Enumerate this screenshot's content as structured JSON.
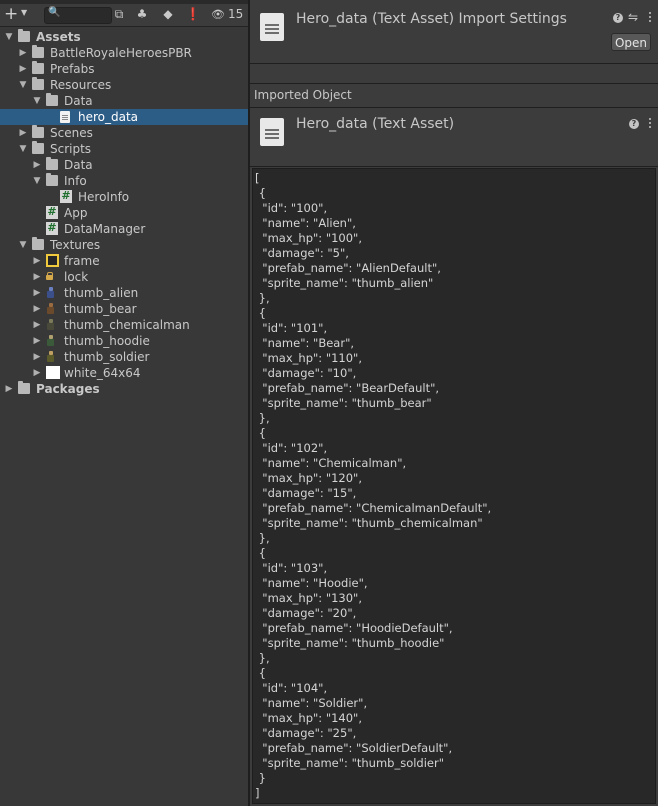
{
  "project": {
    "search": {
      "placeholder": ""
    },
    "hidden_count": "15",
    "tree": [
      {
        "label": "Assets",
        "indent": 0,
        "arrow": "open",
        "icon": "folder",
        "bold": true
      },
      {
        "label": "BattleRoyaleHeroesPBR",
        "indent": 1,
        "arrow": "closed",
        "icon": "folder"
      },
      {
        "label": "Prefabs",
        "indent": 1,
        "arrow": "closed",
        "icon": "folder"
      },
      {
        "label": "Resources",
        "indent": 1,
        "arrow": "open",
        "icon": "folder"
      },
      {
        "label": "Data",
        "indent": 2,
        "arrow": "open",
        "icon": "folder"
      },
      {
        "label": "hero_data",
        "indent": 3,
        "arrow": "none",
        "icon": "text",
        "selected": true
      },
      {
        "label": "Scenes",
        "indent": 1,
        "arrow": "closed",
        "icon": "folder"
      },
      {
        "label": "Scripts",
        "indent": 1,
        "arrow": "open",
        "icon": "folder"
      },
      {
        "label": "Data",
        "indent": 2,
        "arrow": "closed",
        "icon": "folder"
      },
      {
        "label": "Info",
        "indent": 2,
        "arrow": "open",
        "icon": "folder"
      },
      {
        "label": "HeroInfo",
        "indent": 3,
        "arrow": "none",
        "icon": "csharp"
      },
      {
        "label": "App",
        "indent": 2,
        "arrow": "none",
        "icon": "csharp"
      },
      {
        "label": "DataManager",
        "indent": 2,
        "arrow": "none",
        "icon": "csharp"
      },
      {
        "label": "Textures",
        "indent": 1,
        "arrow": "open",
        "icon": "folder"
      },
      {
        "label": "frame",
        "indent": 2,
        "arrow": "closed",
        "icon": "frame"
      },
      {
        "label": "lock",
        "indent": 2,
        "arrow": "closed",
        "icon": "lock"
      },
      {
        "label": "thumb_alien",
        "indent": 2,
        "arrow": "closed",
        "icon": "sprite-alien"
      },
      {
        "label": "thumb_bear",
        "indent": 2,
        "arrow": "closed",
        "icon": "sprite-bear"
      },
      {
        "label": "thumb_chemicalman",
        "indent": 2,
        "arrow": "closed",
        "icon": "sprite-chemicalman"
      },
      {
        "label": "thumb_hoodie",
        "indent": 2,
        "arrow": "closed",
        "icon": "sprite-hoodie"
      },
      {
        "label": "thumb_soldier",
        "indent": 2,
        "arrow": "closed",
        "icon": "sprite-soldier"
      },
      {
        "label": "white_64x64",
        "indent": 2,
        "arrow": "closed",
        "icon": "white"
      },
      {
        "label": "Packages",
        "indent": 0,
        "arrow": "closed",
        "icon": "folder",
        "bold": true
      }
    ]
  },
  "inspector": {
    "header_title": "Hero_data (Text Asset) Import Settings",
    "open_label": "Open",
    "imported_object_label": "Imported Object",
    "object_title": "Hero_data (Text Asset)",
    "text_content": "[\n {\n  \"id\": \"100\",\n  \"name\": \"Alien\",\n  \"max_hp\": \"100\",\n  \"damage\": \"5\",\n  \"prefab_name\": \"AlienDefault\",\n  \"sprite_name\": \"thumb_alien\"\n },\n {\n  \"id\": \"101\",\n  \"name\": \"Bear\",\n  \"max_hp\": \"110\",\n  \"damage\": \"10\",\n  \"prefab_name\": \"BearDefault\",\n  \"sprite_name\": \"thumb_bear\"\n },\n {\n  \"id\": \"102\",\n  \"name\": \"Chemicalman\",\n  \"max_hp\": \"120\",\n  \"damage\": \"15\",\n  \"prefab_name\": \"ChemicalmanDefault\",\n  \"sprite_name\": \"thumb_chemicalman\"\n },\n {\n  \"id\": \"103\",\n  \"name\": \"Hoodie\",\n  \"max_hp\": \"130\",\n  \"damage\": \"20\",\n  \"prefab_name\": \"HoodieDefault\",\n  \"sprite_name\": \"thumb_hoodie\"\n },\n {\n  \"id\": \"104\",\n  \"name\": \"Soldier\",\n  \"max_hp\": \"140\",\n  \"damage\": \"25\",\n  \"prefab_name\": \"SoldierDefault\",\n  \"sprite_name\": \"thumb_soldier\"\n }\n]"
  },
  "colors": {
    "background": "#383838",
    "selection": "#2c5d87",
    "text_area": "#282828"
  }
}
